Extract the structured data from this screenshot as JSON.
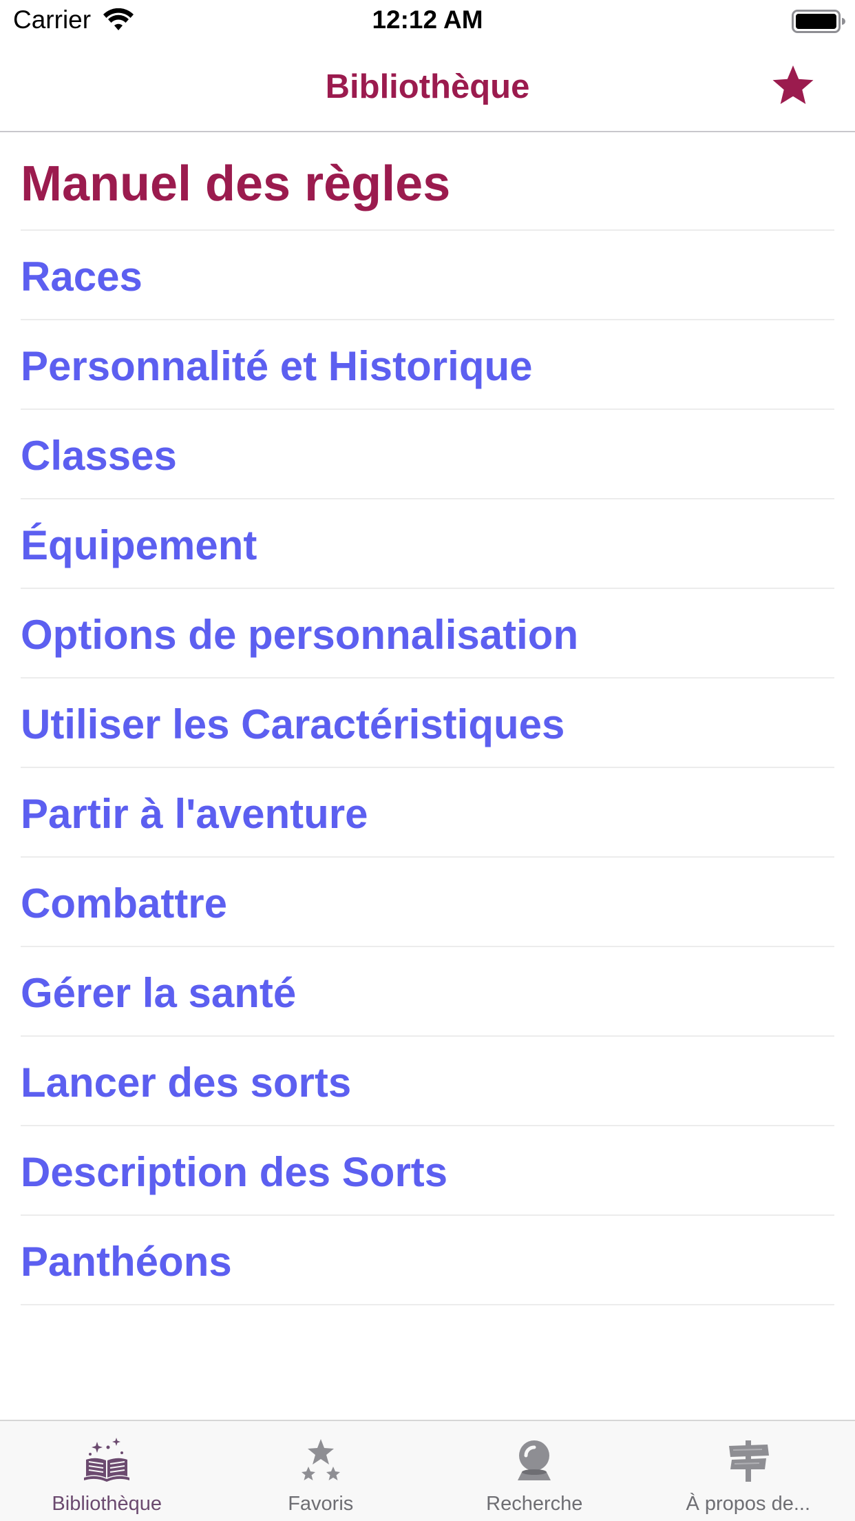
{
  "status_bar": {
    "carrier": "Carrier",
    "time": "12:12 AM"
  },
  "nav": {
    "title": "Bibliothèque",
    "favorite_icon": "star-icon"
  },
  "section": {
    "title": "Manuel des règles"
  },
  "items": [
    {
      "label": "Races"
    },
    {
      "label": "Personnalité et Historique"
    },
    {
      "label": "Classes"
    },
    {
      "label": "Équipement"
    },
    {
      "label": "Options de personnalisation"
    },
    {
      "label": "Utiliser les Caractéristiques"
    },
    {
      "label": "Partir à l'aventure"
    },
    {
      "label": "Combattre"
    },
    {
      "label": "Gérer la santé"
    },
    {
      "label": "Lancer des sorts"
    },
    {
      "label": "Description des Sorts"
    },
    {
      "label": "Panthéons"
    }
  ],
  "tabs": [
    {
      "label": "Bibliothèque",
      "icon": "magic-book-icon",
      "active": true
    },
    {
      "label": "Favoris",
      "icon": "stars-icon",
      "active": false
    },
    {
      "label": "Recherche",
      "icon": "crystal-ball-icon",
      "active": false
    },
    {
      "label": "À propos de...",
      "icon": "signpost-icon",
      "active": false
    }
  ],
  "colors": {
    "accent": "#9b1b4e",
    "link": "#5c5ff0",
    "separator": "#ececec",
    "tab_inactive": "#6e6e73"
  }
}
